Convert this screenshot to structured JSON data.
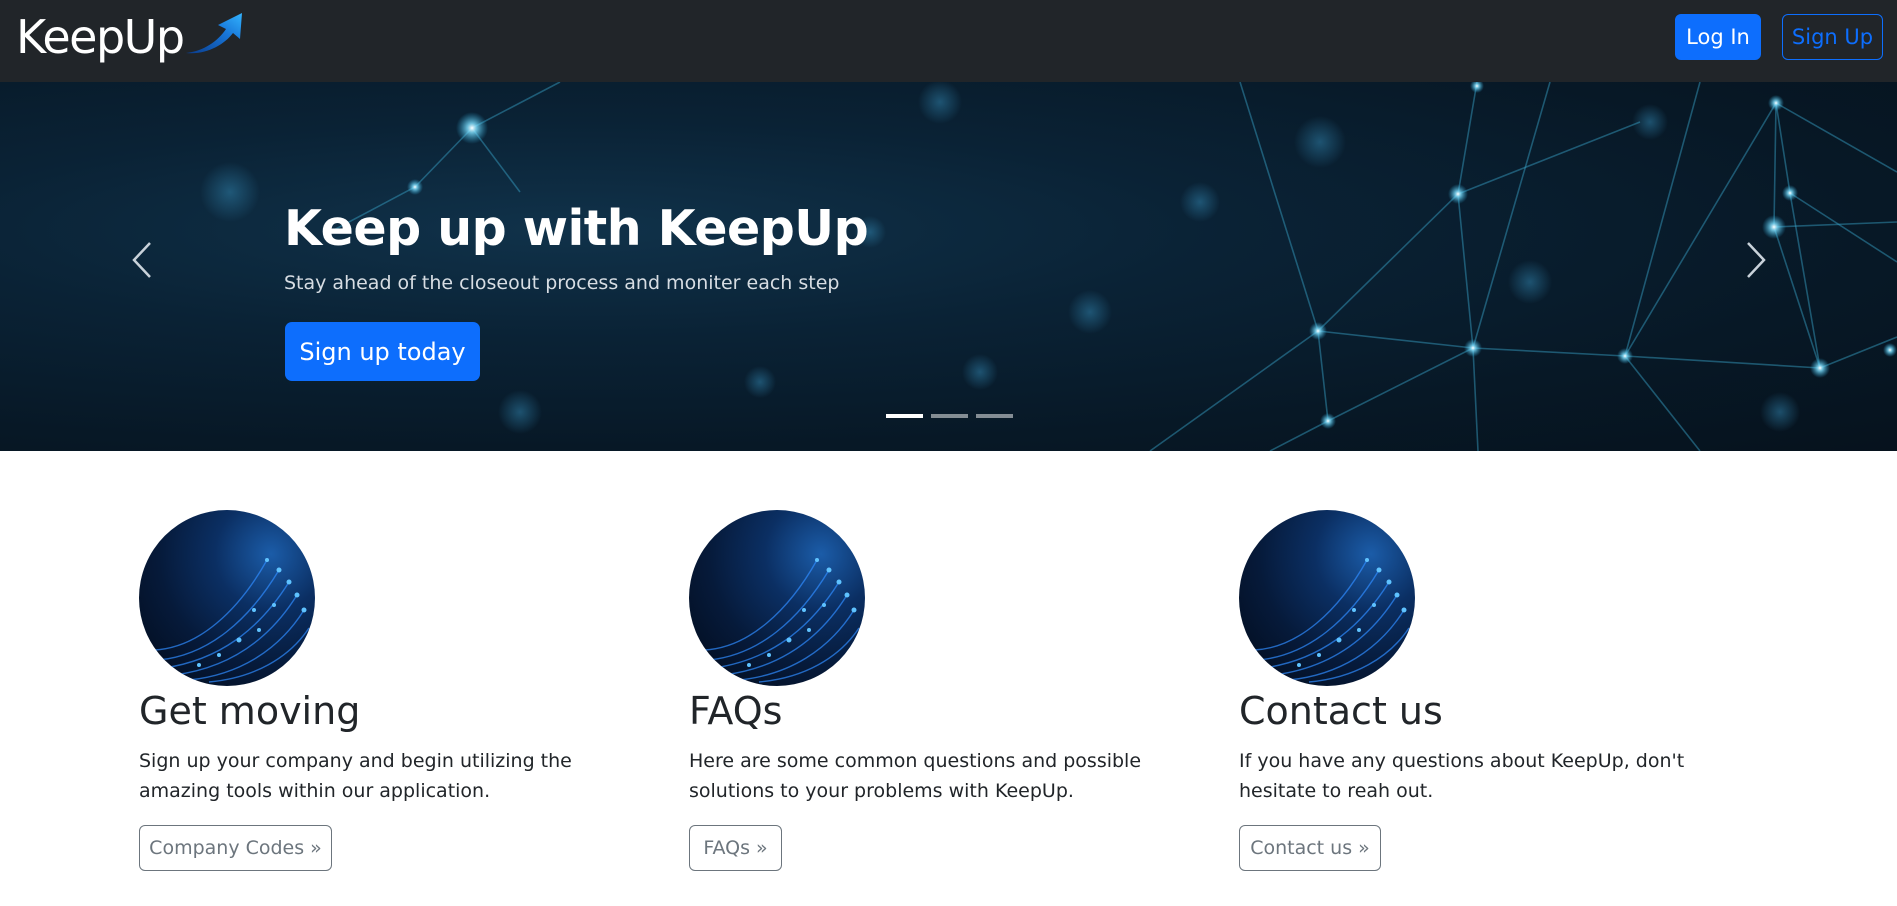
{
  "navbar": {
    "brand": "KeepUp",
    "login_label": "Log In",
    "signup_label": "Sign Up"
  },
  "carousel": {
    "title": "Keep up with KeepUp",
    "subtitle": "Stay ahead of the closeout process and moniter each step",
    "cta_label": "Sign up today",
    "slides": 3,
    "active_slide": 1,
    "prev_icon": "chevron-left-icon",
    "next_icon": "chevron-right-icon"
  },
  "features": [
    {
      "title": "Get moving",
      "text": "Sign up your company and begin utilizing the amazing tools within our application.",
      "button": "Company Codes »"
    },
    {
      "title": "FAQs",
      "text": "Here are some common questions and possible solutions to your problems with KeepUp.",
      "button": "FAQs »"
    },
    {
      "title": "Contact us",
      "text": "If you have any questions about KeepUp, don't hesitate to reah out.",
      "button": "Contact us »"
    }
  ],
  "colors": {
    "navbar_bg": "#212529",
    "primary": "#0d6efd",
    "secondary": "#6c757d"
  }
}
